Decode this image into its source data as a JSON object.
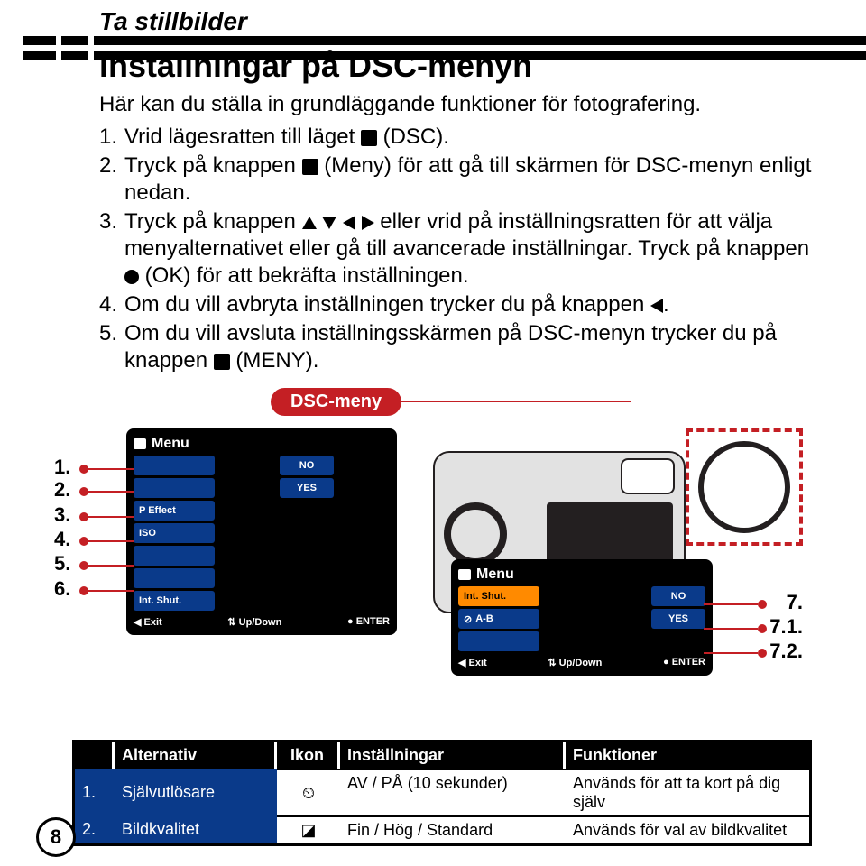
{
  "section_title": "Ta stillbilder",
  "main_title": "Inställningar på DSC-menyn",
  "subtitle": "Här kan du ställa in grundläggande funktioner för fotografering.",
  "steps": {
    "s1_pre": "Vrid lägesratten till läget ",
    "s1_post": " (DSC).",
    "s2_pre": "Tryck på knappen ",
    "s2_post": " (Meny) för att gå till skärmen för DSC-menyn enligt nedan.",
    "s3_pre": "Tryck på knappen ",
    "s3_mid": " eller vrid på inställningsratten för att välja menyalternativet eller gå till avancerade inställningar. Tryck på knappen ",
    "s3_post": " (OK) för att bekräfta inställningen.",
    "s4_pre": "Om du vill avbryta inställningen trycker du på knappen ",
    "s4_post": ".",
    "s5_pre": "Om du vill avsluta inställningsskärmen på DSC-menyn trycker du på knappen ",
    "s5_post": " (MENY)."
  },
  "dsc_label": "DSC-meny",
  "menu1": {
    "title": "Menu",
    "items": [
      "",
      "",
      "P Effect",
      "ISO",
      "",
      "",
      "Int. Shut."
    ],
    "opt_no": "NO",
    "opt_yes": "YES",
    "footer_exit": "Exit",
    "footer_updown": "Up/Down",
    "footer_enter": "ENTER"
  },
  "left_nums": [
    "1.",
    "2.",
    "3.",
    "4.",
    "5.",
    "6."
  ],
  "menu2": {
    "title": "Menu",
    "row1": "Int. Shut.",
    "row1_opt": "NO",
    "row2": "A-B",
    "row2_opt": "YES",
    "footer_exit": "Exit",
    "footer_updown": "Up/Down",
    "footer_enter": "ENTER"
  },
  "right_nums": [
    "7.",
    "7.1.",
    "7.2."
  ],
  "table": {
    "headers": {
      "alternativ": "Alternativ",
      "ikon": "Ikon",
      "installningar": "Inställningar",
      "funktioner": "Funktioner"
    },
    "rows": [
      {
        "num": "1.",
        "alt": "Självutlösare",
        "inst": "AV / PÅ (10 sekunder)",
        "funk": "Används för att ta kort på dig själv"
      },
      {
        "num": "2.",
        "alt": "Bildkvalitet",
        "inst": "Fin / Hög / Standard",
        "funk": "Används för val av bildkvalitet"
      }
    ]
  },
  "page_number": "8"
}
